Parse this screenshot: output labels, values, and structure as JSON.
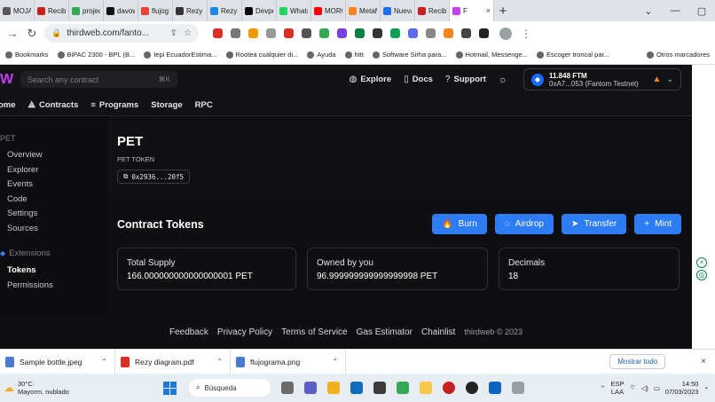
{
  "browser": {
    "tabs": [
      {
        "label": "MOJA",
        "color": "#5a5a5a"
      },
      {
        "label": "Recibi",
        "color": "#c5221f"
      },
      {
        "label": "project",
        "color": "#34a853"
      },
      {
        "label": "davow",
        "color": "#111111"
      },
      {
        "label": "flujog",
        "color": "#ea4335"
      },
      {
        "label": "Rezy",
        "color": "#333333"
      },
      {
        "label": "Rezy W",
        "color": "#1e88e5"
      },
      {
        "label": "Devpo",
        "color": "#0a0a0a"
      },
      {
        "label": "Whats",
        "color": "#25d366"
      },
      {
        "label": "MORO",
        "color": "#ff0000"
      },
      {
        "label": "MetaM",
        "color": "#f6851b"
      },
      {
        "label": "Nueva",
        "color": "#1a73e8"
      },
      {
        "label": "Recibi",
        "color": "#c5221f"
      },
      {
        "label": "F",
        "color": "#c53ff0",
        "active": true
      }
    ],
    "url": "thirdweb.com/fanto...",
    "bookmarks": [
      "Bookmarks",
      "BiPAC 2300 - BPL (B...",
      "Iepi EcuadorEstima...",
      "Rootea cualquier di...",
      "Ayuda",
      "httt",
      "Software Sirha para...",
      "Hotmail, Messenge...",
      "Escoger troncal par...",
      "Otros marcadores"
    ]
  },
  "header": {
    "search_placeholder": "Search any contract",
    "search_shortcut": "⌘K",
    "nav": [
      {
        "label": "Explore",
        "icon": "globe-icon",
        "glyph": "◍"
      },
      {
        "label": "Docs",
        "icon": "document-icon",
        "glyph": "▯"
      },
      {
        "label": "Support",
        "icon": "help-icon",
        "glyph": "?"
      }
    ],
    "wallet": {
      "balance": "11.848 FTM",
      "address": "0xA7...053 (Fantom Testnet)"
    }
  },
  "subnav": [
    "ome",
    "Contracts",
    "Programs",
    "Storage",
    "RPC"
  ],
  "sidebar": {
    "title": "PET",
    "items": [
      "Overview",
      "Explorer",
      "Events",
      "Code",
      "Settings",
      "Sources"
    ],
    "section": "Extensions",
    "ext_items": [
      "Tokens",
      "Permissions"
    ]
  },
  "contract": {
    "name": "PET",
    "symbol": "PET TOKEN",
    "address": "0x2936...20f5"
  },
  "tokens": {
    "title": "Contract Tokens",
    "actions": [
      {
        "label": "Burn",
        "glyph": "🔥"
      },
      {
        "label": "Airdrop",
        "glyph": "◌"
      },
      {
        "label": "Transfer",
        "glyph": "➤"
      },
      {
        "label": "Mint",
        "glyph": "+"
      }
    ],
    "stats": [
      {
        "label": "Total Supply",
        "value": "166.000000000000000001 PET"
      },
      {
        "label": "Owned by you",
        "value": "96.999999999999999998 PET"
      },
      {
        "label": "Decimals",
        "value": "18"
      }
    ]
  },
  "footer": {
    "links": [
      "Feedback",
      "Privacy Policy",
      "Terms of Service",
      "Gas Estimator",
      "Chainlist"
    ],
    "copyright": "thirdweb © 2023"
  },
  "downloads": {
    "items": [
      {
        "name": "Sample bottle.jpeg",
        "color": "#4a7bd1"
      },
      {
        "name": "Rezy diagram.pdf",
        "color": "#d93025"
      },
      {
        "name": "flujograma.png",
        "color": "#4a7bd1"
      }
    ],
    "show_all": "Mostrar todo"
  },
  "taskbar": {
    "temp": "30°C",
    "weather": "Mayorm. nublado",
    "search": "Búsqueda",
    "lang": "ESP",
    "lang2": "LAA",
    "time": "14:50",
    "date": "07/03/2023"
  }
}
